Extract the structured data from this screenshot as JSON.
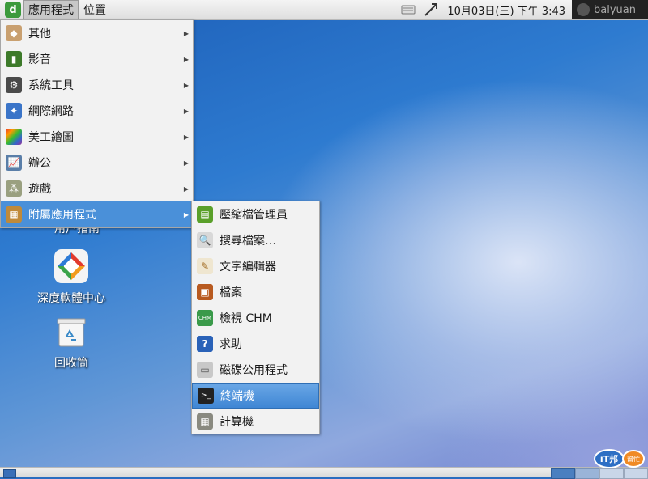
{
  "top_panel": {
    "menu_applications": "應用程式",
    "menu_places": "位置",
    "clock": "10月03日(三) 下午  3:43",
    "username": "balyuan"
  },
  "apps_menu": {
    "items": [
      {
        "label": "其他",
        "icon": "misc-icon",
        "color": "#c9a070"
      },
      {
        "label": "影音",
        "icon": "multimedia-icon",
        "color": "#3d7a2a"
      },
      {
        "label": "系統工具",
        "icon": "system-tools-icon",
        "color": "#4a4a4a"
      },
      {
        "label": "網際網路",
        "icon": "internet-icon",
        "color": "#3a74c8"
      },
      {
        "label": "美工繪圖",
        "icon": "graphics-icon",
        "color": "#d0506a"
      },
      {
        "label": "辦公",
        "icon": "office-icon",
        "color": "#5a7ea8"
      },
      {
        "label": "遊戲",
        "icon": "games-icon",
        "color": "#9aa080"
      },
      {
        "label": "附屬應用程式",
        "icon": "accessories-icon",
        "color": "#c08a3a"
      }
    ]
  },
  "accessories_menu": {
    "items": [
      {
        "label": "壓縮檔管理員",
        "icon": "archive-manager-icon",
        "color": "#5aa02a"
      },
      {
        "label": "搜尋檔案…",
        "icon": "search-files-icon",
        "color": "#8a8a8a"
      },
      {
        "label": "文字編輯器",
        "icon": "text-editor-icon",
        "color": "#b08a50"
      },
      {
        "label": "檔案",
        "icon": "file-manager-icon",
        "color": "#b85a20"
      },
      {
        "label": "檢視 CHM",
        "icon": "chm-viewer-icon",
        "color": "#3a9a4a"
      },
      {
        "label": "求助",
        "icon": "help-icon",
        "color": "#2a62b8"
      },
      {
        "label": "磁碟公用程式",
        "icon": "disk-utility-icon",
        "color": "#9a9a9a"
      },
      {
        "label": "終端機",
        "icon": "terminal-icon",
        "color": "#222222"
      },
      {
        "label": "計算機",
        "icon": "calculator-icon",
        "color": "#7a7a70"
      }
    ]
  },
  "desktop": {
    "icons": [
      {
        "label": "用户指南"
      },
      {
        "label": "深度軟體中心"
      },
      {
        "label": "回收筒"
      }
    ]
  },
  "colors": {
    "highlight": "#4a90d9"
  }
}
